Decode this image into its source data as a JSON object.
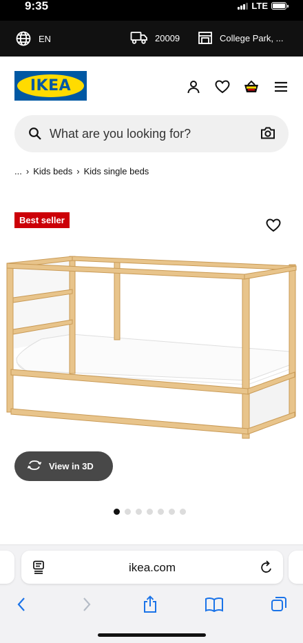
{
  "status_bar": {
    "time": "9:35",
    "network": "LTE",
    "signal_bars": 3
  },
  "top_bar": {
    "language": "EN",
    "zip_code": "20009",
    "store": "College Park, ..."
  },
  "header": {
    "logo_text": "IKEA",
    "brand_blue": "#0058a3",
    "brand_yellow": "#ffdb00"
  },
  "search": {
    "placeholder": "What are you looking for?"
  },
  "breadcrumb": {
    "ellipsis": "...",
    "items": [
      {
        "label": "Kids beds"
      },
      {
        "label": "Kids single beds"
      }
    ]
  },
  "product": {
    "badge": "Best seller",
    "badge_color": "#cc0008",
    "view_3d_label": "View in 3D",
    "image_count": 7,
    "active_image": 1
  },
  "browser": {
    "url": "ikea.com"
  },
  "icons": {
    "globe": "globe-icon",
    "truck": "truck-icon",
    "store": "store-icon",
    "account": "account-icon",
    "favourites": "heart-icon",
    "bag": "shopping-bag-icon",
    "menu": "menu-icon",
    "search": "search-icon",
    "camera": "camera-icon",
    "rotate": "rotate-3d-icon"
  }
}
